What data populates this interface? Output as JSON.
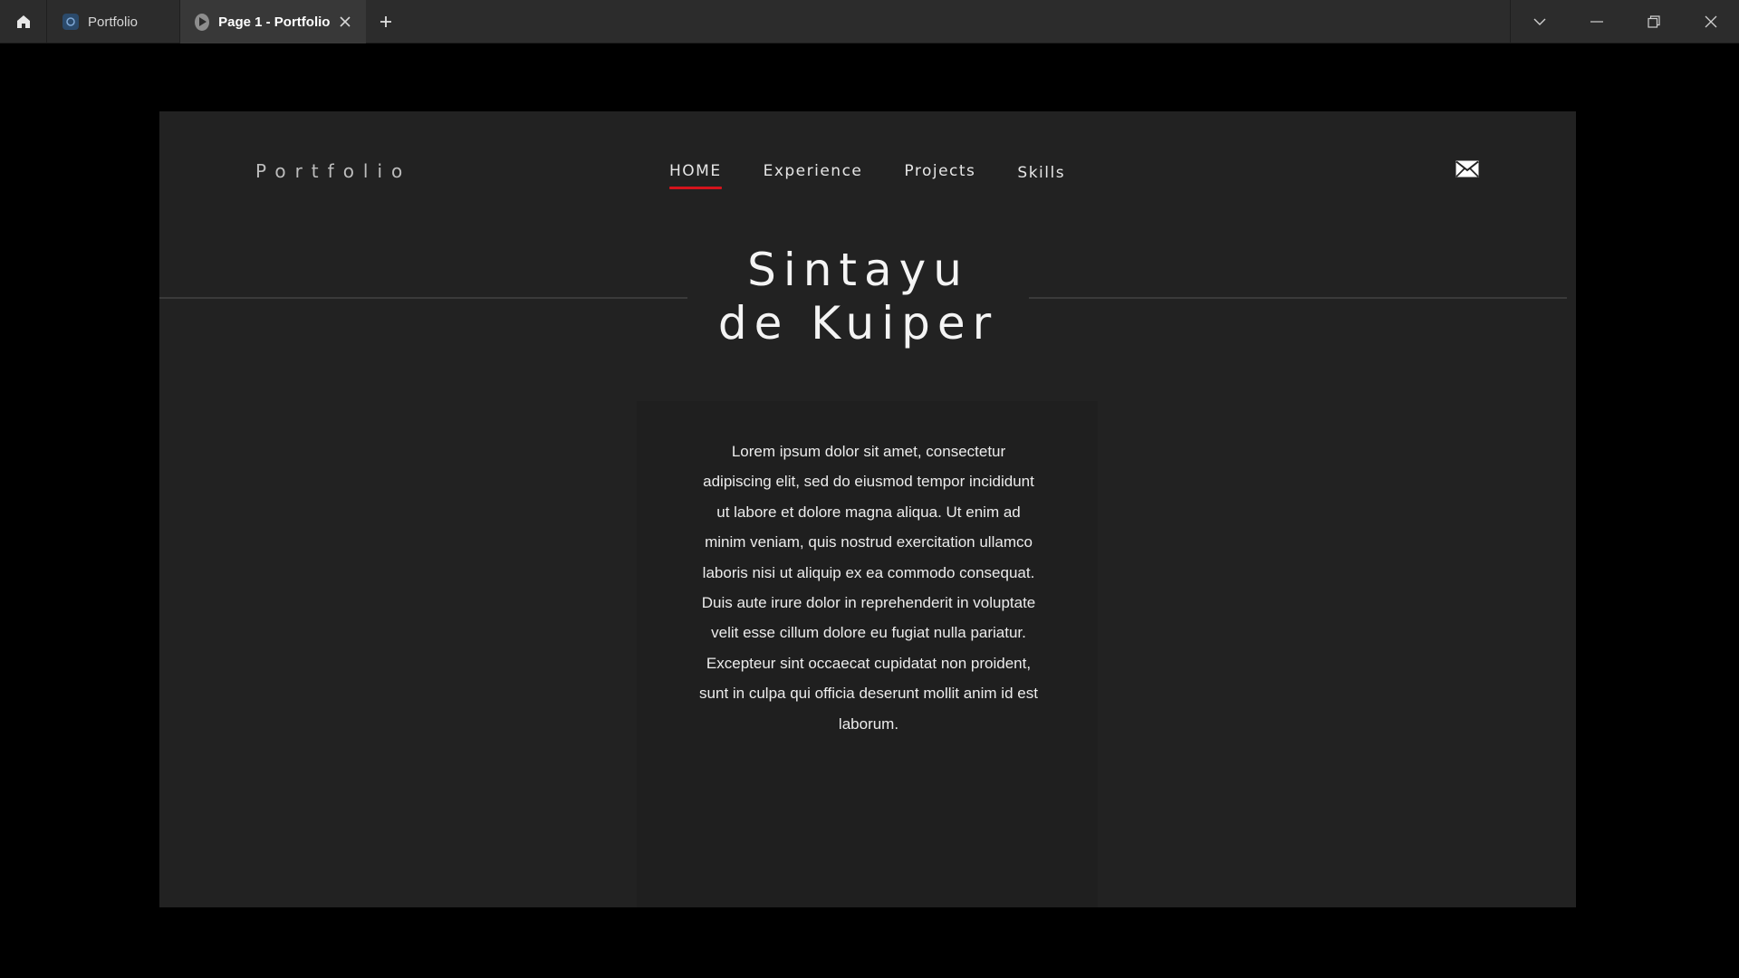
{
  "titlebar": {
    "tabs": [
      {
        "label": "Portfolio"
      },
      {
        "label": "Page 1 - Portfolio"
      }
    ]
  },
  "site": {
    "brand": "Portfolio",
    "nav": [
      "HOME",
      "Experience",
      "Projects",
      "Skills"
    ],
    "active_nav": "HOME",
    "name_line1": "Sintayu",
    "name_line2": "de Kuiper",
    "intro": "Lorem ipsum dolor sit amet, consectetur adipiscing elit, sed do eiusmod tempor incididunt ut labore et dolore magna aliqua. Ut enim ad minim veniam, quis nostrud exercitation ullamco laboris nisi ut aliquip ex ea commodo consequat. Duis aute irure dolor in reprehenderit in voluptate velit esse cillum dolore eu fugiat nulla pariatur. Excepteur sint occaecat cupidatat non proident, sunt in culpa qui officia deserunt mollit anim id est laborum."
  },
  "colors": {
    "accent": "#d4141c",
    "page_bg": "#222222",
    "card_bg": "#1f1f1f",
    "chrome_bg": "#2c2c2c"
  },
  "icons": [
    "home-icon",
    "file-icon",
    "play-icon",
    "close-icon",
    "plus-icon",
    "chevron-down-icon",
    "minimize-icon",
    "restore-icon",
    "mail-icon"
  ]
}
